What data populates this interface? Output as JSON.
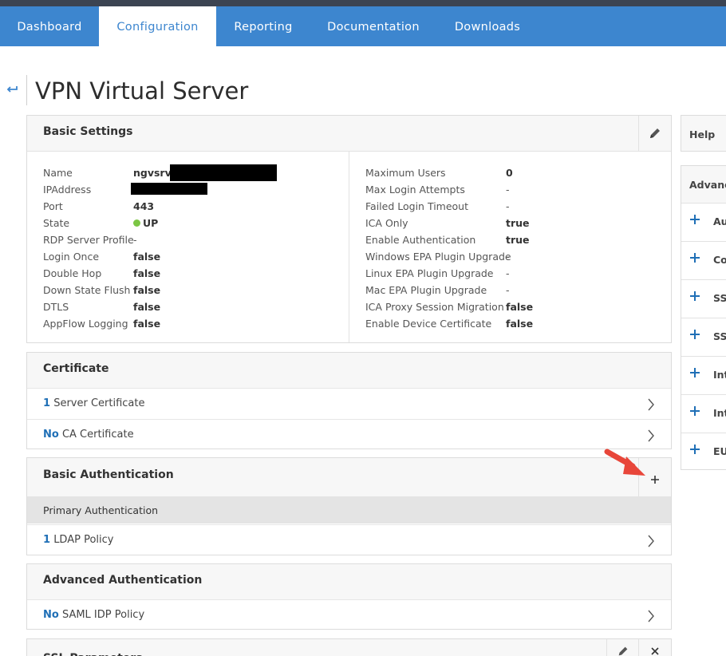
{
  "nav": {
    "tabs": [
      {
        "label": "Dashboard"
      },
      {
        "label": "Configuration"
      },
      {
        "label": "Reporting"
      },
      {
        "label": "Documentation"
      },
      {
        "label": "Downloads"
      }
    ],
    "active_tab": "Configuration"
  },
  "page": {
    "title": "VPN Virtual Server"
  },
  "basic_settings": {
    "title": "Basic Settings",
    "left": [
      {
        "label": "Name",
        "value": "ngvsrv_"
      },
      {
        "label": "IPAddress",
        "value": ""
      },
      {
        "label": "Port",
        "value": "443"
      },
      {
        "label": "State",
        "value": "UP"
      },
      {
        "label": "RDP Server Profile",
        "value": "-"
      },
      {
        "label": "Login Once",
        "value": "false"
      },
      {
        "label": "Double Hop",
        "value": "false"
      },
      {
        "label": "Down State Flush",
        "value": "false"
      },
      {
        "label": "DTLS",
        "value": "false"
      },
      {
        "label": "AppFlow Logging",
        "value": "false"
      }
    ],
    "right": [
      {
        "label": "Maximum Users",
        "value": "0"
      },
      {
        "label": "Max Login Attempts",
        "value": "-"
      },
      {
        "label": "Failed Login Timeout",
        "value": "-"
      },
      {
        "label": "ICA Only",
        "value": "true"
      },
      {
        "label": "Enable Authentication",
        "value": "true"
      },
      {
        "label": "Windows EPA Plugin Upgrade",
        "value": "-"
      },
      {
        "label": "Linux EPA Plugin Upgrade",
        "value": "-"
      },
      {
        "label": "Mac EPA Plugin Upgrade",
        "value": "-"
      },
      {
        "label": "ICA Proxy Session Migration",
        "value": "false"
      },
      {
        "label": "Enable Device Certificate",
        "value": "false"
      }
    ]
  },
  "certificate": {
    "title": "Certificate",
    "rows": [
      {
        "count": "1",
        "label": "Server Certificate"
      },
      {
        "count": "No",
        "label": "CA Certificate"
      }
    ]
  },
  "basic_auth": {
    "title": "Basic Authentication",
    "subheader": "Primary Authentication",
    "rows": [
      {
        "count": "1",
        "label": "LDAP Policy"
      }
    ]
  },
  "advanced_auth": {
    "title": "Advanced Authentication",
    "rows": [
      {
        "count": "No",
        "label": "SAML IDP Policy"
      }
    ]
  },
  "ssl_parameters": {
    "title": "SSL Parameters"
  },
  "sidebar": {
    "help": "Help",
    "advanced_title": "Advance",
    "items": [
      {
        "label": "Au"
      },
      {
        "label": "Co"
      },
      {
        "label": "SSI"
      },
      {
        "label": "SSI"
      },
      {
        "label": "Int"
      },
      {
        "label": "Int"
      },
      {
        "label": "EU"
      }
    ]
  },
  "colors": {
    "nav_bg": "#3d86cf",
    "accent_blue": "#1f6fb6",
    "status_up": "#7cc644",
    "annotation_arrow": "#e8463a"
  },
  "icons": {
    "back": "back-arrow-icon",
    "edit": "pencil-icon",
    "add": "plus-icon",
    "close": "close-icon",
    "chevron": "chevron-right-icon"
  }
}
